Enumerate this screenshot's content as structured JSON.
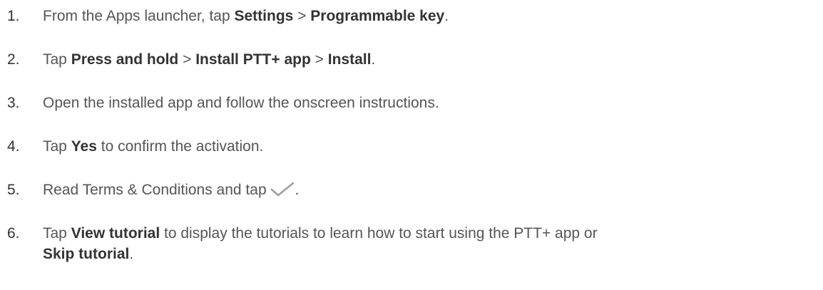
{
  "steps": [
    {
      "number": "1.",
      "parts": [
        {
          "text": "From the Apps launcher, tap ",
          "bold": false
        },
        {
          "text": "Settings",
          "bold": true
        },
        {
          "text": " > ",
          "bold": false
        },
        {
          "text": "Programmable key",
          "bold": true
        },
        {
          "text": ".",
          "bold": false
        }
      ]
    },
    {
      "number": "2.",
      "parts": [
        {
          "text": "Tap ",
          "bold": false
        },
        {
          "text": "Press and hold",
          "bold": true
        },
        {
          "text": " > ",
          "bold": false
        },
        {
          "text": "Install PTT+ app",
          "bold": true
        },
        {
          "text": " > ",
          "bold": false
        },
        {
          "text": "Install",
          "bold": true
        },
        {
          "text": ".",
          "bold": false
        }
      ]
    },
    {
      "number": "3.",
      "parts": [
        {
          "text": "Open the installed app and follow the onscreen instructions.",
          "bold": false
        }
      ]
    },
    {
      "number": "4.",
      "parts": [
        {
          "text": "Tap ",
          "bold": false
        },
        {
          "text": "Yes",
          "bold": true
        },
        {
          "text": " to confirm the activation.",
          "bold": false
        }
      ]
    },
    {
      "number": "5.",
      "parts": [
        {
          "text": "Read Terms & Conditions and tap ",
          "bold": false
        },
        {
          "icon": "checkmark-icon"
        },
        {
          "text": ".",
          "bold": false
        }
      ]
    },
    {
      "number": "6.",
      "parts": [
        {
          "text": "Tap ",
          "bold": false
        },
        {
          "text": "View tutorial",
          "bold": true
        },
        {
          "text": " to display the tutorials to learn how to start using the PTT+ app or",
          "bold": false
        },
        {
          "break": true
        },
        {
          "text": "Skip tutorial",
          "bold": true
        },
        {
          "text": ".",
          "bold": false
        }
      ]
    }
  ],
  "colors": {
    "text": "#555555",
    "emphasis": "#333333",
    "icon": "#9e9e9e"
  }
}
